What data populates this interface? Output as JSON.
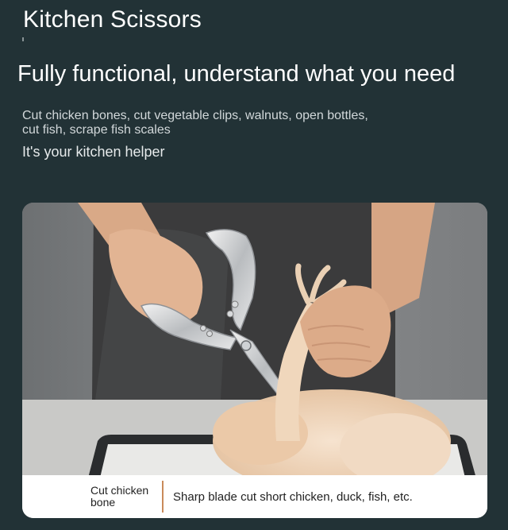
{
  "header": {
    "title": "Kitchen Scissors",
    "headline": "Fully functional, understand what you need"
  },
  "description": {
    "line1": "Cut chicken bones, cut vegetable clips, walnuts, open bottles,",
    "line2": "cut fish, scrape fish scales",
    "helper": "It's your kitchen helper"
  },
  "caption": {
    "left": "Cut chicken bone",
    "right": "Sharp blade cut short chicken, duck, fish, etc."
  },
  "colors": {
    "background": "#223236",
    "text": "#ffffff",
    "divider_accent": "#c98a5a"
  }
}
